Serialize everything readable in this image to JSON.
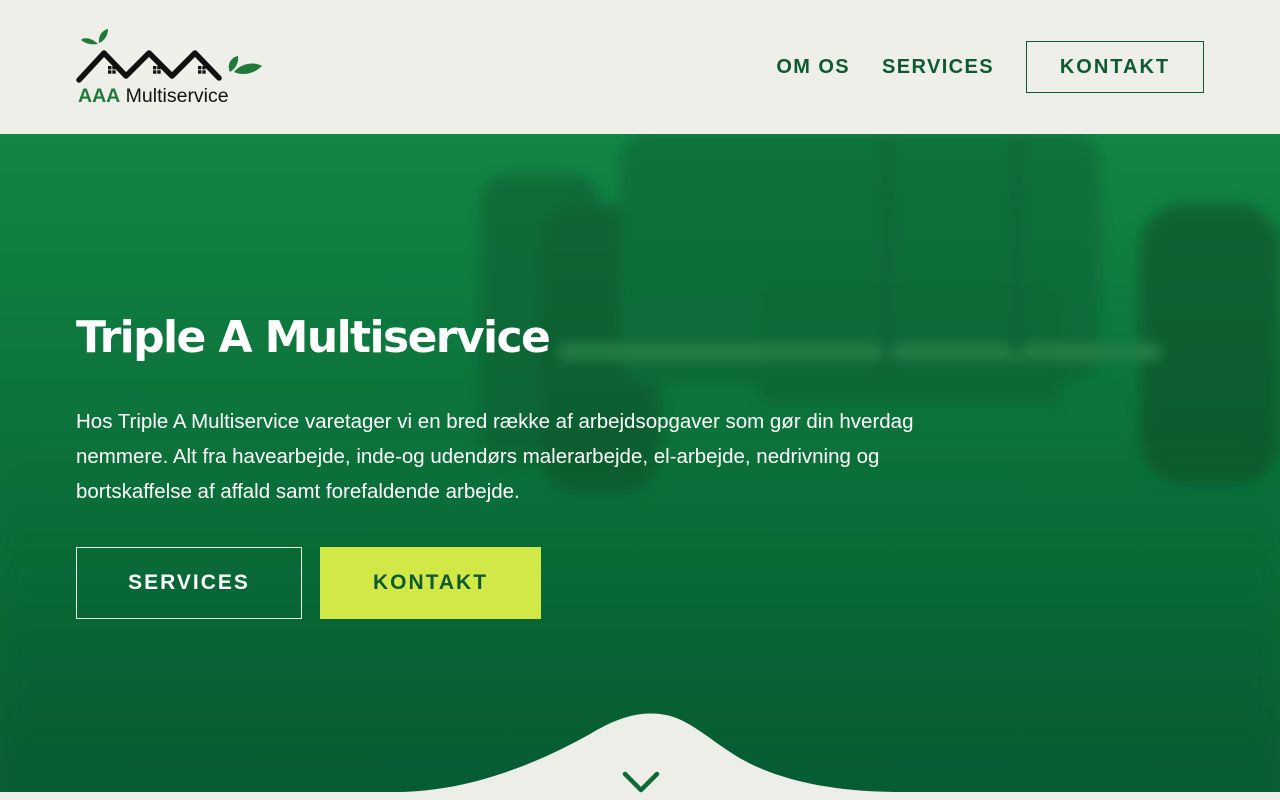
{
  "header": {
    "logo": {
      "brand_accent": "AAA",
      "brand_text": "Multiservice"
    },
    "nav": {
      "about_label": "OM OS",
      "services_label": "SERVICES",
      "contact_label": "KONTAKT"
    }
  },
  "hero": {
    "title": "Triple A Multiservice",
    "description": "Hos Triple A Multiservice varetager vi en bred række af arbejdsopgaver som gør din hverdag nemmere. Alt fra havearbejde, inde-og udendørs malerarbejde, el-arbejde, nedrivning og bortskaffelse af affald samt forefaldende arbejde.",
    "buttons": {
      "services_label": "SERVICES",
      "contact_label": "KONTAKT"
    },
    "scroll_icon": "chevron-down-icon"
  },
  "colors": {
    "header_bg": "#efefe9",
    "brand_green": "#0e5a2f",
    "logo_green": "#1f7a3a",
    "hero_green": "#0c743c",
    "accent_lime": "#d1e847",
    "white": "#ffffff"
  }
}
